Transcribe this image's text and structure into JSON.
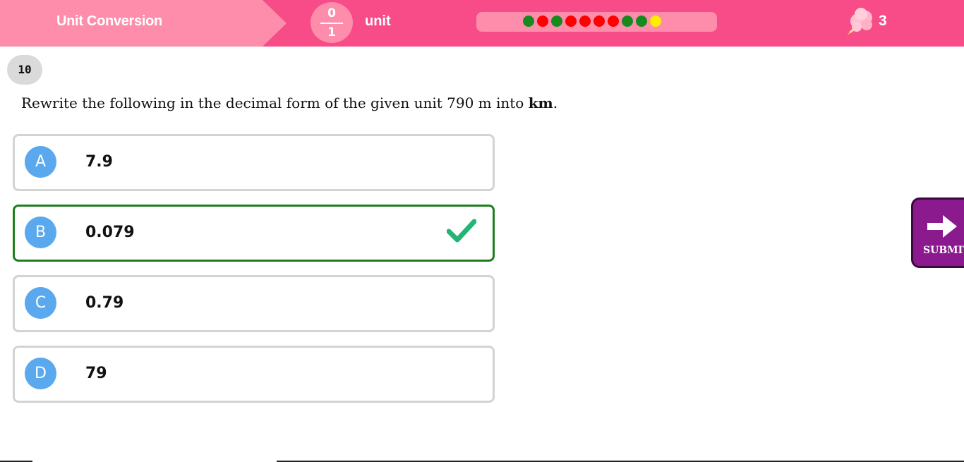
{
  "header": {
    "title": "Unit Conversion",
    "fraction": {
      "numerator": "0",
      "denominator": "1"
    },
    "unit_label": "unit",
    "progress_dots": [
      "#178a1e",
      "#ff0000",
      "#178a1e",
      "#ff0000",
      "#ff0000",
      "#ff0000",
      "#ff0000",
      "#178a1e",
      "#178a1e",
      "#ffee00"
    ],
    "score": "3",
    "score_icon": "cotton-candy-icon"
  },
  "question": {
    "number": "10",
    "text_prefix": "Rewrite the following in the decimal form of the given unit 790 m into ",
    "text_bold": "km",
    "text_suffix": "."
  },
  "options": [
    {
      "letter": "A",
      "value": "7.9",
      "selected": false
    },
    {
      "letter": "B",
      "value": "0.079",
      "selected": true
    },
    {
      "letter": "C",
      "value": "0.79",
      "selected": false
    },
    {
      "letter": "D",
      "value": "79",
      "selected": false
    }
  ],
  "submit": {
    "label": "SUBMIT",
    "icon": "arrow-right-icon"
  },
  "colors": {
    "header_bg": "#f74c87",
    "header_light": "#fd8dab",
    "option_letter_bg": "#5aa9ef",
    "selected_border": "#1e7e1e",
    "check": "#22b573",
    "submit_bg": "#8b1a8f"
  }
}
